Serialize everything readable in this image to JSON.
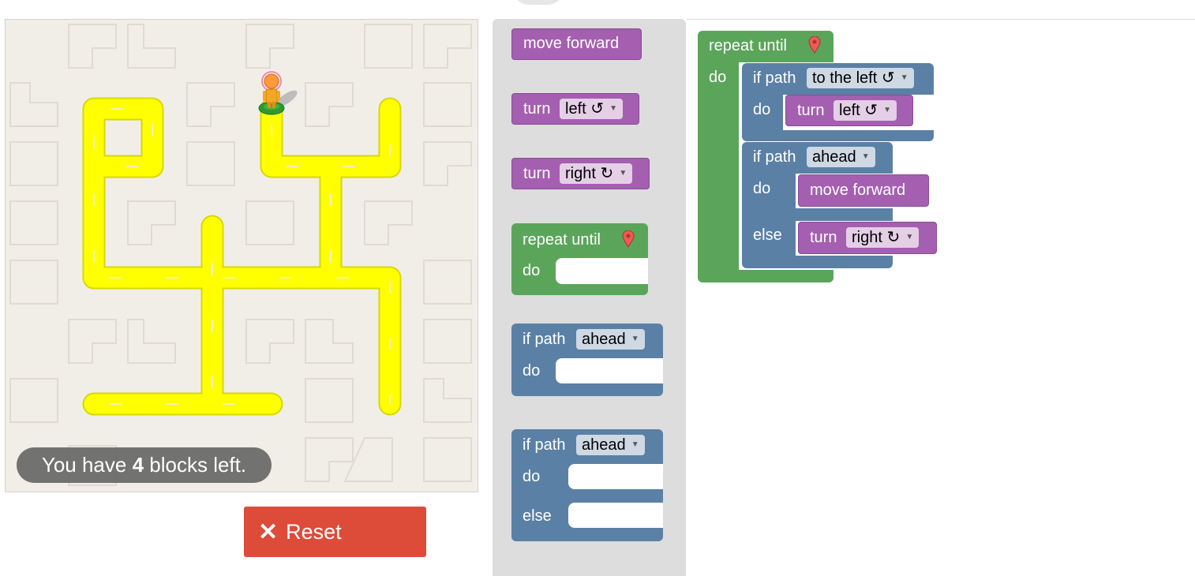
{
  "status": {
    "prefix": "You have ",
    "count": "4",
    "suffix": " blocks left."
  },
  "reset": {
    "icon": "close-icon",
    "label": "Reset"
  },
  "toolbox": {
    "move_forward": "move forward",
    "turn": "turn",
    "left_option": "left ↺",
    "right_option": "right ↻",
    "repeat_until": "repeat until",
    "do": "do",
    "else": "else",
    "if_path": "if path",
    "ahead_option": "ahead"
  },
  "workspace": {
    "repeat_until": "repeat until",
    "do": "do",
    "if_path": "if path",
    "to_the_left": "to the left ↺",
    "turn": "turn",
    "left_option": "left ↺",
    "ahead_option": "ahead",
    "move_forward": "move forward",
    "else": "else",
    "right_option": "right ↻"
  },
  "colors": {
    "path": "#ffff00",
    "motion_block": "#a55fb0",
    "logic_block": "#5b80a5",
    "loop_block": "#5ba55b",
    "reset": "#dd4b39"
  }
}
